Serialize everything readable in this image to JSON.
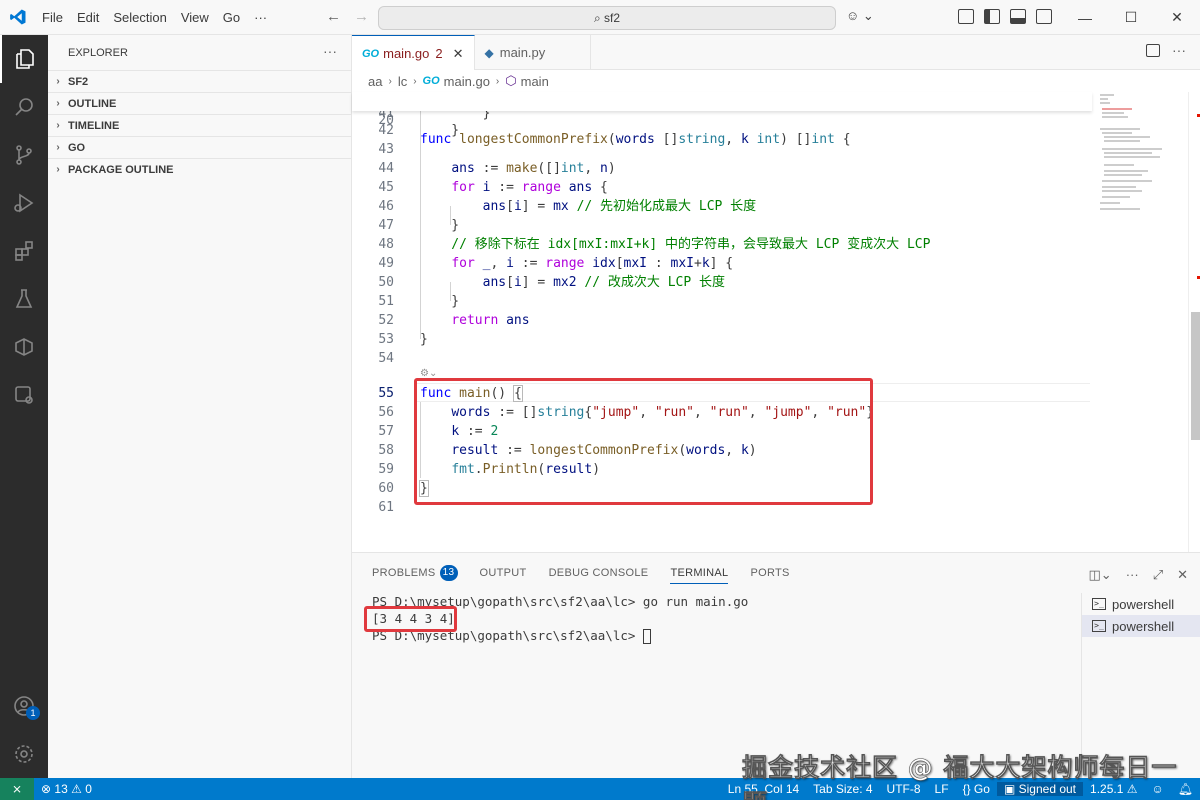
{
  "titlebar": {
    "menus": [
      "File",
      "Edit",
      "Selection",
      "View",
      "Go"
    ],
    "menu_more": "···",
    "command_center": "sf2",
    "win_minimize": "—",
    "win_maximize": "☐",
    "win_close": "✕"
  },
  "sidebar": {
    "title": "EXPLORER",
    "more": "···",
    "sections": [
      "SF2",
      "OUTLINE",
      "TIMELINE",
      "GO",
      "PACKAGE OUTLINE"
    ]
  },
  "activity_bar": {
    "accounts_badge": "1",
    "icons": [
      "explorer-icon",
      "search-icon",
      "source-control-icon",
      "run-debug-icon",
      "extensions-icon",
      "testing-icon",
      "go-icon",
      "remote-explorer-icon",
      "accounts-icon",
      "settings-gear-icon"
    ]
  },
  "tabs": [
    {
      "label": "main.go",
      "problems": "2",
      "active": true,
      "icon": "go-file-icon"
    },
    {
      "label": "main.py",
      "active": false,
      "icon": "python-file-icon"
    }
  ],
  "breadcrumb": [
    "aa",
    "lc",
    "main.go",
    "main"
  ],
  "editor": {
    "sticky": {
      "n": "20",
      "text": "func longestCommonPrefix(words []string, k int) []int {"
    },
    "lines": [
      {
        "n": "41",
        "text": "        }"
      },
      {
        "n": "42",
        "text": "    }"
      },
      {
        "n": "43",
        "text": ""
      },
      {
        "n": "44",
        "text": "    ans := make([]int, n)"
      },
      {
        "n": "45",
        "text": "    for i := range ans {"
      },
      {
        "n": "46",
        "text": "        ans[i] = mx // 先初始化成最大 LCP 长度"
      },
      {
        "n": "47",
        "text": "    }"
      },
      {
        "n": "48",
        "text": "    // 移除下标在 idx[mxI:mxI+k] 中的字符串，会导致最大 LCP 变成次大 LCP"
      },
      {
        "n": "49",
        "text": "    for _, i := range idx[mxI : mxI+k] {"
      },
      {
        "n": "50",
        "text": "        ans[i] = mx2 // 改成次大 LCP 长度"
      },
      {
        "n": "51",
        "text": "    }"
      },
      {
        "n": "52",
        "text": "    return ans"
      },
      {
        "n": "53",
        "text": "}"
      },
      {
        "n": "54",
        "text": ""
      },
      {
        "n": "55",
        "text": "func main() {"
      },
      {
        "n": "56",
        "text": "    words := []string{\"jump\", \"run\", \"run\", \"jump\", \"run\"}"
      },
      {
        "n": "57",
        "text": "    k := 2"
      },
      {
        "n": "58",
        "text": "    result := longestCommonPrefix(words, k)"
      },
      {
        "n": "59",
        "text": "    fmt.Println(result)"
      },
      {
        "n": "60",
        "text": "}"
      },
      {
        "n": "61",
        "text": ""
      }
    ],
    "current_line": "55"
  },
  "panel": {
    "tabs": [
      "PROBLEMS",
      "OUTPUT",
      "DEBUG CONSOLE",
      "TERMINAL",
      "PORTS"
    ],
    "problems_count": "13",
    "active_tab": "TERMINAL",
    "terminal_lines": [
      "PS D:\\mysetup\\gopath\\src\\sf2\\aa\\lc> go run main.go",
      "[3 4 4 3 4]",
      "PS D:\\mysetup\\gopath\\src\\sf2\\aa\\lc> "
    ],
    "terminals": [
      "powershell",
      "powershell"
    ]
  },
  "statusbar": {
    "errors": "13",
    "warnings": "0",
    "position": "Ln 55, Col 14",
    "tab_size": "Tab Size: 4",
    "encoding": "UTF-8",
    "eol": "LF",
    "language": "Go",
    "account": "Signed out",
    "go_version": "1.25.1"
  },
  "watermark": "掘金技术社区 @ 福大大架构师每日一题",
  "colors": {
    "accent": "#005fb8",
    "statusbar": "#007acc",
    "annotation_red": "#e0393e",
    "activity_bar": "#2c2c2c"
  }
}
